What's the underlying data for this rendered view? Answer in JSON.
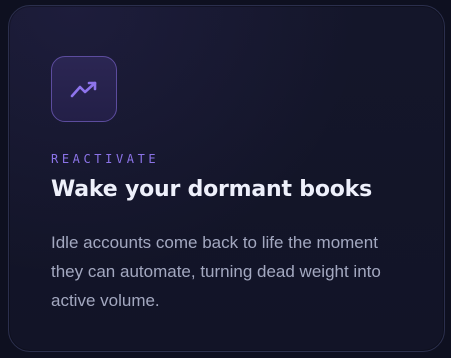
{
  "card": {
    "icon": "trending-up-icon",
    "eyebrow": "REACTIVATE",
    "title": "Wake your dormant books",
    "body": "Idle accounts come back to life the moment they can automate, turning dead weight into active volume."
  },
  "colors": {
    "background": "#0e1020",
    "card_border": "#2b2f4d",
    "accent": "#8b73e8",
    "title": "#eef0fb",
    "body": "#a3a8c0"
  }
}
